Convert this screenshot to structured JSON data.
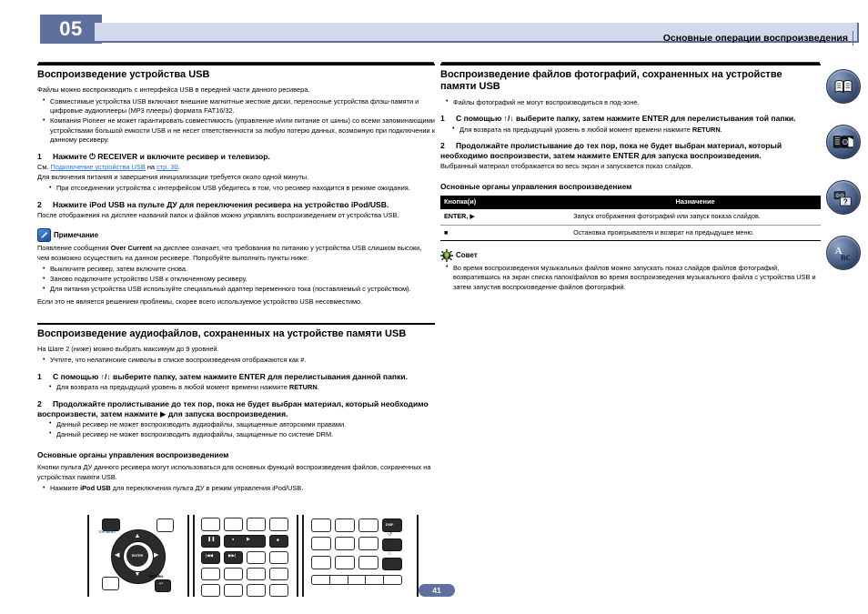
{
  "header": {
    "chapter_number": "05",
    "title": "Основные операции воспроизведения"
  },
  "left_column": {
    "section1": {
      "heading": "Воспроизведение устройства USB",
      "intro": "Файлы можно воспроизводить с интерфейса USB в передней части данного ресивера.",
      "bullets": [
        "Совместимые устройства USB включают внешние магнитные жесткие диски, переносные устройства флэш-памяти и цифровые аудиоплееры (MP3 плееры) формата FAT16/32.",
        "Компания Pioneer не может гарантировать совместимость (управление и/или питание от шины) со всеми запоминающими устройствами большой емкости USB и не несет ответственности за любую потерю данных, возможную при подключении к данному ресиверу."
      ],
      "step1_num": "1",
      "step1_text": "Нажмите ⏻ RECEIVER и включите ресивер и телевизор.",
      "see_prefix": "См. ",
      "see_link1": "Подключение устройства USB",
      "see_mid": " на ",
      "see_link2": "стр. 30",
      "see_suffix": ".",
      "step1_note": "Для включения питания и завершения инициализации требуется около одной минуты.",
      "step1_bullets": [
        "При отсоединении устройства с интерфейсом USB убедитесь в том, что ресивер находится в режиме ожидания."
      ],
      "step2_num": "2",
      "step2_text": "Нажмите iPod USB на пульте ДУ для переключения ресивера на устройство iPod/USB.",
      "step2_note": "После отображения на дисплее названий папок и файлов можно управлять воспроизведением от устройства USB."
    },
    "note": {
      "icon": "note-pencil-icon",
      "label": "Примечание",
      "body_pre": "Появление сообщения ",
      "body_bold": "Over Current",
      "body_post": " на дисплее означает, что требования по питанию у устройства USB слишком высоки, чем возможно осуществить на данном ресивере. Попробуйте выполнить пункты ниже:",
      "bullets": [
        "Выключите ресивер, затем включите снова.",
        "Заново подключите устройство USB к отключенному ресиверу.",
        "Для питания устройства USB используйте специальный адаптер переменного тока (поставляемый с устройством)."
      ],
      "footer": "Если это не является решением проблемы, скорее всего используемое устройство USB несовместимо."
    },
    "section2": {
      "heading": "Воспроизведение аудиофайлов, сохраненных на устройстве памяти USB",
      "intro": "На Шаге 2 (ниже) можно выбрать максимум до 9 уровней.",
      "bullets": [
        "Учтите, что нелатинские символы в списке воспроизведения отображаются как #."
      ],
      "step1_num": "1",
      "step1_text": "С помощью ↑/↓ выберите папку, затем нажмите ENTER для перелистывания данной папки.",
      "step1_bullets_pre": "Для возврата на предыдущий уровень в любой момент времени нажмите ",
      "step1_bullets_bold": "RETURN",
      "step1_bullets_post": ".",
      "step2_num": "2",
      "step2_text": "Продолжайте пролистывание до тех пор, пока не будет выбран материал, который необходимо воспроизвести, затем нажмите ▶ для запуска воспроизведения.",
      "step2_bullets": [
        "Данный ресивер не может воспроизводить аудиофайлы, защищенные авторскими правами.",
        "Данный ресивер не может воспроизводить аудиофайлы, защищенные по системе DRM."
      ]
    },
    "controls": {
      "heading": "Основные органы управления воспроизведением",
      "body": "Кнопки пульта ДУ данного ресивера могут использоваться для основных функций воспроизведения файлов, сохраненных на устройствах памяти USB.",
      "bullet_pre": "Нажмите ",
      "bullet_bold": "iPod USB",
      "bullet_post": " для переключения пульта ДУ в режим управления iPod/USB."
    }
  },
  "right_column": {
    "section": {
      "heading": "Воспроизведение файлов фотографий, сохраненных на устройстве памяти USB",
      "bullets": [
        "Файлы фотографий не могут воспроизводиться в под-зоне."
      ],
      "step1_num": "1",
      "step1_text": "С помощью ↑/↓ выберите папку, затем нажмите ENTER для перелистывания той папки.",
      "step1_bullet_pre": "Для возврата на предыдущий уровень в любой момент времени нажмите ",
      "step1_bullet_bold": "RETURN",
      "step1_bullet_post": ".",
      "step2_num": "2",
      "step2_text": "Продолжайте пролистывание до тех пор, пока не будет выбран материал, который необходимо воспроизвести, затем нажмите ENTER для запуска воспроизведения.",
      "step2_note": "Выбранный материал отображается во весь экран и запускается показ слайдов."
    },
    "controls": {
      "heading": "Основные органы управления воспроизведением",
      "table": {
        "columns": [
          "Кнопка(и)",
          "Назначение"
        ],
        "rows": [
          [
            "ENTER, ▶",
            "Запуск отображения фотографий или запуск показа слайдов."
          ],
          [
            "■",
            "Остановка проигрывателя и возврат на предыдущее меню."
          ]
        ]
      }
    },
    "tip": {
      "icon": "tip-bulb-icon",
      "label": "Совет",
      "bullets": [
        "Во время воспроизведения музыкальных файлов можно запускать показ слайдов файлов фотографий, возвратившись на экран списка папок/файлов во время воспроизведения музыкального файла с устройства USB и затем запустив воспроизведение файлов фотографий."
      ]
    }
  },
  "rail_icons": [
    {
      "name": "book-icon"
    },
    {
      "name": "receiver-icon"
    },
    {
      "name": "faq-icon"
    },
    {
      "name": "glossary-abc-icon"
    }
  ],
  "remote": {
    "top_menu_label": "TOP MENU",
    "return_label": "RETURN",
    "enter_label": "ENTER",
    "disp_label": "DISP"
  },
  "footer": {
    "page_number": "41"
  },
  "colors": {
    "accent": "#5f6f9e",
    "header_bar": "#d3d9ea",
    "link": "#2d6fd4"
  }
}
